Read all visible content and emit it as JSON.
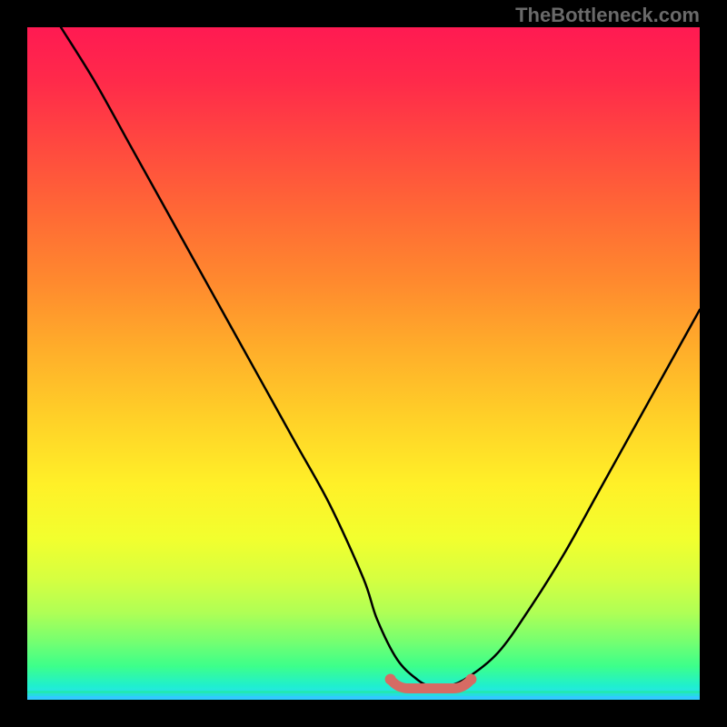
{
  "watermark": "TheBottleneck.com",
  "chart_data": {
    "type": "line",
    "title": "",
    "xlabel": "",
    "ylabel": "",
    "xlim": [
      0,
      100
    ],
    "ylim": [
      0,
      100
    ],
    "curve": {
      "name": "bottleneck-curve",
      "x": [
        5,
        10,
        15,
        20,
        25,
        30,
        35,
        40,
        45,
        50,
        52,
        55,
        58,
        60,
        62,
        65,
        70,
        75,
        80,
        85,
        90,
        95,
        100
      ],
      "y": [
        100,
        92,
        83,
        74,
        65,
        56,
        47,
        38,
        29,
        18,
        12,
        6,
        3,
        2,
        2,
        3,
        7,
        14,
        22,
        31,
        40,
        49,
        58
      ]
    },
    "flat_region": {
      "x_start": 54,
      "x_end": 66,
      "y": 2.5,
      "color": "#d66b64"
    },
    "gradient_stops": [
      {
        "pos": 0.0,
        "color": "#ff1a52"
      },
      {
        "pos": 0.5,
        "color": "#ffd028"
      },
      {
        "pos": 0.8,
        "color": "#d6ff40"
      },
      {
        "pos": 0.95,
        "color": "#3dff8a"
      },
      {
        "pos": 1.0,
        "color": "#30d8ff"
      }
    ]
  }
}
